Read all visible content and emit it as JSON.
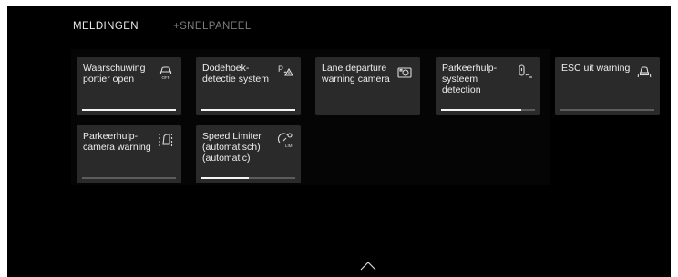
{
  "tabs": [
    {
      "label": "MELDINGEN",
      "active": true
    },
    {
      "label": "+SNELPANEEL",
      "active": false
    }
  ],
  "tiles": [
    {
      "label": "Waarschuwing portier open",
      "icon": "door-off-icon",
      "progress": 1.0
    },
    {
      "label": "Dodehoek-detectie system",
      "icon": "blind-spot-warning-icon",
      "progress": 1.0
    },
    {
      "label": "Lane departure warning camera",
      "icon": "camera-icon",
      "progress": 0
    },
    {
      "label": "Parkeerhulp-systeem detection",
      "icon": "parking-sensor-icon",
      "progress": 0.85
    },
    {
      "label": "ESC uit warning",
      "icon": "esc-skid-icon",
      "progress": 0
    },
    {
      "label": "Parkeerhulp-camera warning",
      "icon": "parking-camera-icon",
      "progress": 0
    },
    {
      "label": "Speed Limiter (automatisch) (automatic)",
      "icon": "speed-limiter-icon",
      "progress": 0.5
    }
  ],
  "footer": {
    "chevron": "chevron-up-icon"
  },
  "colors": {
    "background": "#000000",
    "tile": "#2a2a2a",
    "text": "#ededed",
    "inactive_tab": "#7c7c7c",
    "bar_track": "#5c5c5c",
    "bar_fill": "#f4f4f4"
  }
}
